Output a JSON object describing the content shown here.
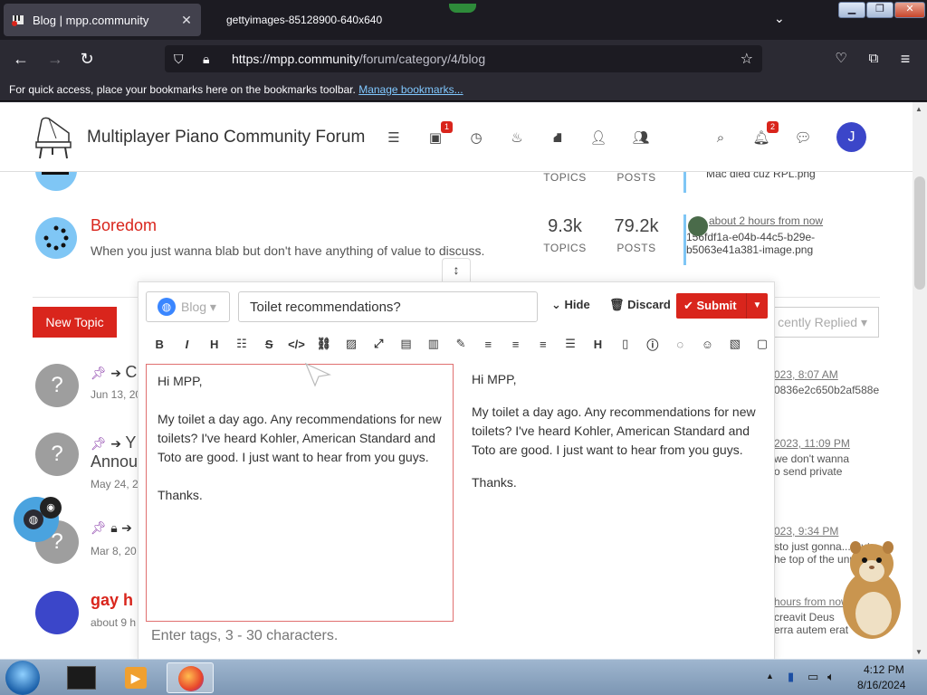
{
  "browser": {
    "active_tab_title": "Blog | mpp.community",
    "second_tab_title": "gettyimages-85128900-640x640",
    "url_host": "https://mpp.community",
    "url_path": "/forum/category/4/blog",
    "bookmarks_text": "For quick access, place your bookmarks here on the bookmarks toolbar.",
    "bookmarks_link": "Manage bookmarks..."
  },
  "header": {
    "site_title": "Multiplayer Piano Community Forum",
    "inbox_badge": "1",
    "notif_badge": "2",
    "avatar_letter": "J"
  },
  "categories": [
    {
      "topics": "",
      "posts": "",
      "topics_label": "TOPICS",
      "posts_label": "POSTS",
      "last_post": "Mac died cuz RPL.png"
    },
    {
      "name": "Boredom",
      "description": "When you just wanna blab but don't have anything of value to discuss.",
      "topics": "9.3k",
      "posts": "79.2k",
      "topics_label": "TOPICS",
      "posts_label": "POSTS",
      "last_time": "about 2 hours from now",
      "last_post_line1": "156fdf1a-e04b-44c5-b29e-",
      "last_post_line2": "b5063e41a381-image.png"
    }
  ],
  "list": {
    "new_topic": "New Topic",
    "sort_label": "cently Replied"
  },
  "topics": [
    {
      "avatar": "?",
      "title": "C",
      "meta": "Jun 13, 20",
      "time": "023, 8:07 AM",
      "snippet": "0836e2c650b2af588e"
    },
    {
      "avatar": "?",
      "title": "Y",
      "title2": "Annou",
      "meta": "May 24, 2",
      "time": "2023, 11:09 PM",
      "snippet": "we don't wanna",
      "snippet2": "o send private"
    },
    {
      "avatar": "?",
      "title": "",
      "meta": "Mar 8, 20",
      "time": "023, 9:34 PM",
      "snippet": "sto just gonna... Put",
      "snippet2": "he top of the unr"
    },
    {
      "avatar": "",
      "title": "gay h",
      "meta": "about 9 h",
      "time": "hours from now",
      "snippet": "creavit Deus",
      "snippet2": "erra autem erat"
    }
  ],
  "composer": {
    "category_placeholder": "Blog",
    "title_value": "Toilet recommendations?",
    "hide_label": "Hide",
    "discard_label": "Discard",
    "submit_label": "Submit",
    "editor_text": "Hi MPP,\n\nMy toilet a day ago. Any recommendations for new toilets? I've heard Kohler, American Standard and Toto are good. I just want to hear from you guys.\n\nThanks.",
    "preview_p1": "Hi MPP,",
    "preview_p2": "My toilet a day ago. Any recommendations for new toilets? I've heard Kohler, American Standard and Toto are good. I just want to hear from you guys.",
    "preview_p3": "Thanks.",
    "tags_placeholder": "Enter tags, 3 - 30 characters.",
    "toolbar": [
      "bold",
      "italic",
      "heading",
      "list",
      "strikethrough",
      "code",
      "link",
      "image",
      "expand",
      "card",
      "chart",
      "pen",
      "align-left",
      "align-center",
      "align-right",
      "justify",
      "heading-alt",
      "file",
      "info",
      "hide-preview",
      "emoji",
      "image-upload",
      "copy"
    ]
  },
  "taskbar": {
    "time": "4:12 PM",
    "date": "8/16/2024"
  }
}
